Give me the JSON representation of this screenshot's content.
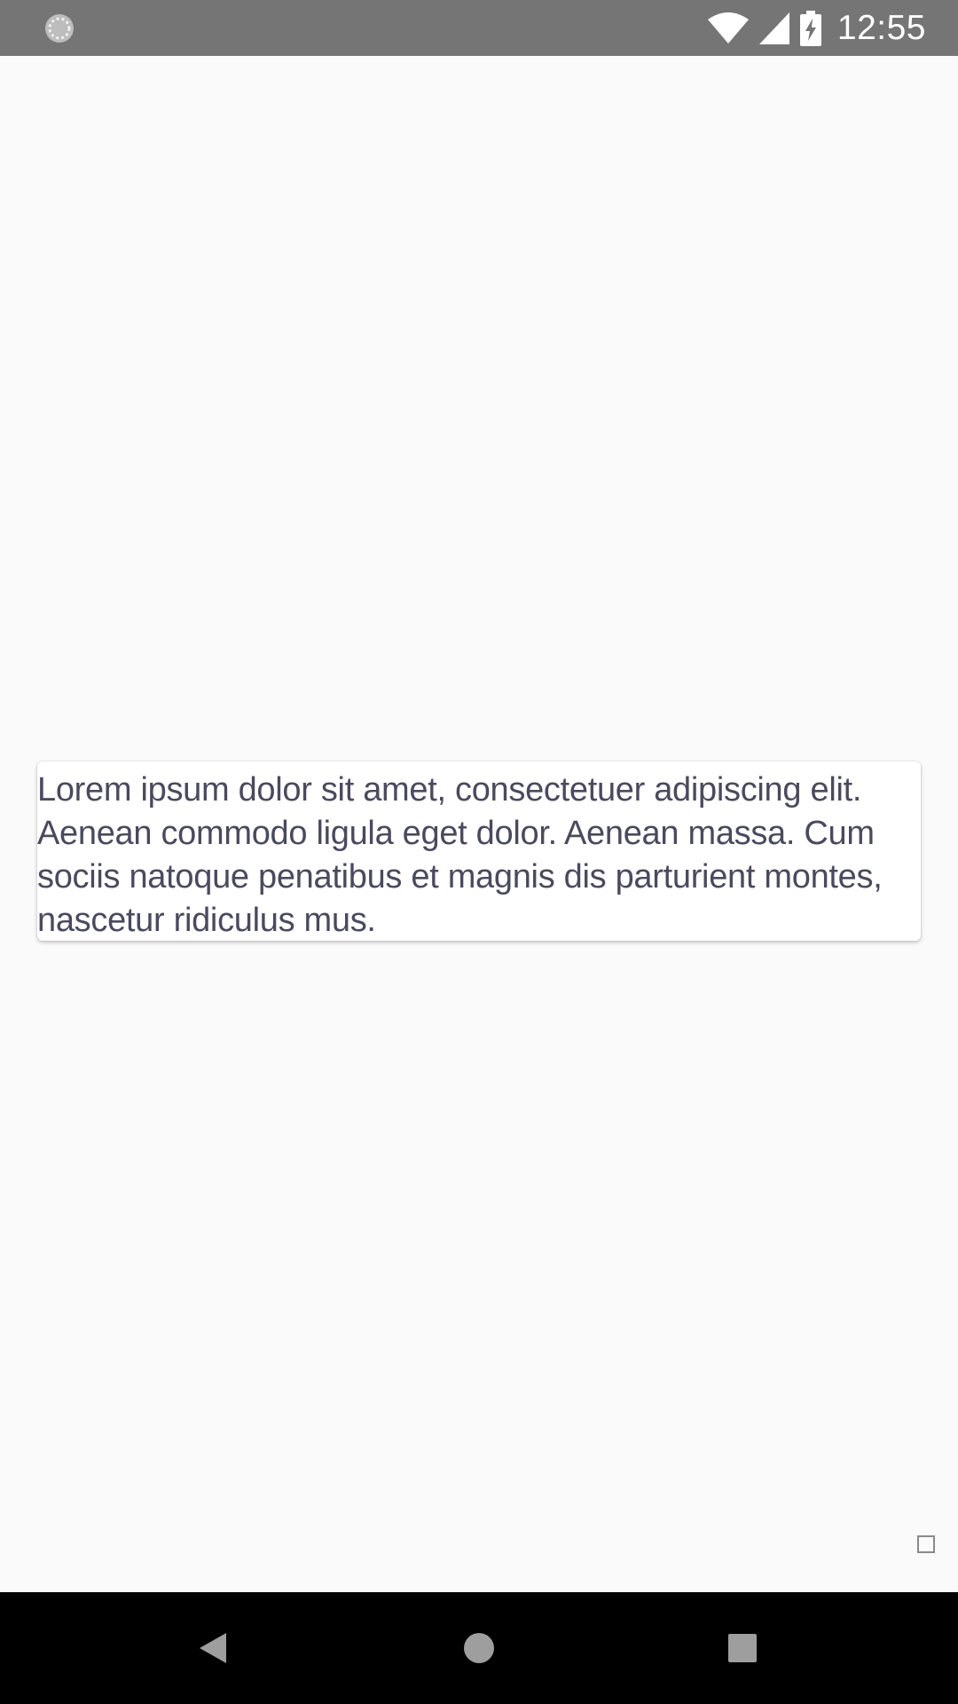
{
  "status_bar": {
    "time": "12:55",
    "left_icon": "loading-circle-icon",
    "icons": [
      "wifi-icon",
      "cell-signal-icon",
      "battery-charging-icon"
    ]
  },
  "main": {
    "card_text": "Lorem ipsum dolor sit amet, consectetuer adipiscing elit. Aenean commodo ligula eget dolor. Aenean massa. Cum sociis natoque penatibus et magnis dis parturient montes, nascetur ridiculus mus."
  },
  "nav_bar": {
    "icons": [
      "back-icon",
      "home-icon",
      "recents-icon"
    ]
  },
  "colors": {
    "status_bar_bg": "#757575",
    "page_bg": "#fafafa",
    "card_bg": "#ffffff",
    "card_text": "#4a4a5e",
    "nav_bar_bg": "#000000"
  }
}
